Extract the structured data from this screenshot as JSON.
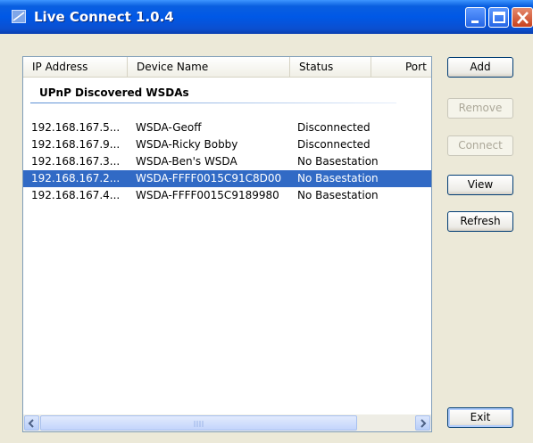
{
  "window": {
    "title": "Live Connect 1.0.4"
  },
  "list": {
    "columns": [
      "IP Address",
      "Device Name",
      "Status",
      "Port"
    ],
    "group_title": "UPnP Discovered WSDAs",
    "rows": [
      {
        "ip": "192.168.167.5...",
        "name": "WSDA-Geoff",
        "status": "Disconnected",
        "selected": false
      },
      {
        "ip": "192.168.167.9...",
        "name": "WSDA-Ricky Bobby",
        "status": "Disconnected",
        "selected": false
      },
      {
        "ip": "192.168.167.3...",
        "name": "WSDA-Ben's WSDA",
        "status": "No Basestation",
        "selected": false
      },
      {
        "ip": "192.168.167.2...",
        "name": "WSDA-FFFF0015C91C8D00",
        "status": "No Basestation",
        "selected": true
      },
      {
        "ip": "192.168.167.4...",
        "name": "WSDA-FFFF0015C9189980",
        "status": "No Basestation",
        "selected": false
      }
    ]
  },
  "buttons": {
    "add": "Add",
    "remove": "Remove",
    "connect": "Connect",
    "view": "View",
    "refresh": "Refresh",
    "exit": "Exit"
  },
  "button_states": {
    "remove_enabled": false,
    "connect_enabled": false
  },
  "colors": {
    "selection": "#316ac5",
    "titlebar": "#0058e6",
    "client": "#ece9d8"
  },
  "icons": [
    "app-icon",
    "minimize-icon",
    "maximize-icon",
    "close-icon",
    "scroll-left-icon",
    "scroll-right-icon"
  ]
}
